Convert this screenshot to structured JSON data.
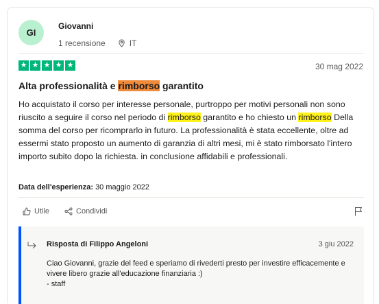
{
  "reviewer": {
    "initials": "GI",
    "name": "Giovanni",
    "review_count": "1 recensione",
    "country": "IT",
    "avatar_color": "#b9f0cf"
  },
  "review": {
    "rating": 5,
    "star_color": "#00b67a",
    "date": "30 mag 2022",
    "title_parts": [
      "Alta professionalità e ",
      "rimborso",
      " garantito"
    ],
    "body_parts": [
      "Ho acquistato il corso per interesse personale, purtroppo per motivi personali non sono riuscito a seguire il corso nel periodo di ",
      "rimborso",
      " garantito e ho chiesto un ",
      "rimborso",
      " Della somma del corso per ricomprarlo in futuro. La professionalità è stata eccellente, oltre ad essermi stato proposto un aumento di garanzia di altri mesi, mi è stato rimborsato l'intero importo subito dopo la richiesta. in conclusione affidabili e professionali."
    ],
    "experience_label": "Data dell'esperienza:",
    "experience_date": "30 maggio 2022"
  },
  "actions": {
    "useful": "Utile",
    "share": "Condividi"
  },
  "reply": {
    "title": "Risposta di Filippo Angeloni",
    "date": "3 giu 2022",
    "line1": "Ciao Giovanni, grazie del feed e speriamo di rivederti presto per investire efficacemente e vivere libero grazie all'educazione finanziaria :)",
    "line2": "- staff",
    "accent_color": "#0051ff"
  }
}
